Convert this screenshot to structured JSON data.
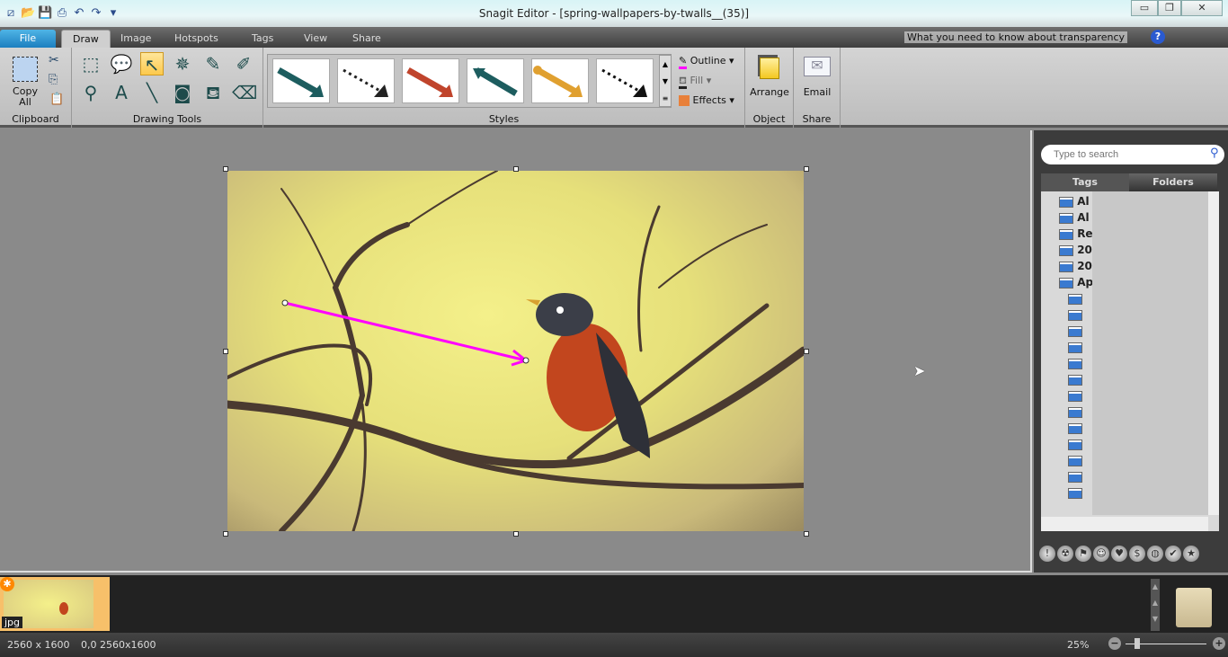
{
  "window": {
    "title": "Snagit Editor - [spring-wallpapers-by-twalls__(35)]",
    "minimize": "▭",
    "restore": "❐",
    "close": "✕"
  },
  "quick_access": [
    {
      "icon": "snagit-logo-icon",
      "glyph": "⧄"
    },
    {
      "icon": "open-folder-icon",
      "glyph": "📂"
    },
    {
      "icon": "save-icon",
      "glyph": "💾"
    },
    {
      "icon": "print-icon",
      "glyph": "⎙"
    },
    {
      "icon": "undo-icon",
      "glyph": "↶"
    },
    {
      "icon": "redo-icon",
      "glyph": "↷"
    },
    {
      "icon": "customize-icon",
      "glyph": "▾"
    }
  ],
  "tabs": [
    {
      "label": "File"
    },
    {
      "label": "Draw"
    },
    {
      "label": "Image"
    },
    {
      "label": "Hotspots"
    },
    {
      "label": "Tags"
    },
    {
      "label": "View"
    },
    {
      "label": "Share"
    }
  ],
  "active_tab": "Draw",
  "help_text": "What you need to know about transparency",
  "ribbon": {
    "clipboard": {
      "label": "Clipboard",
      "copy_all": "Copy\nAll",
      "copy_all_line1": "Copy",
      "copy_all_line2": "All"
    },
    "drawing_tools": {
      "label": "Drawing Tools",
      "tools": [
        {
          "name": "selection",
          "glyph": "⬚"
        },
        {
          "name": "callout",
          "glyph": "💬"
        },
        {
          "name": "arrow",
          "glyph": "↖",
          "selected": true
        },
        {
          "name": "stamp",
          "glyph": "✵"
        },
        {
          "name": "pen",
          "glyph": "✎"
        },
        {
          "name": "highlighter",
          "glyph": "✐"
        },
        {
          "name": "magnifier",
          "glyph": "⚲"
        },
        {
          "name": "text",
          "glyph": "A"
        },
        {
          "name": "line",
          "glyph": "╲"
        },
        {
          "name": "shape",
          "glyph": "◙"
        },
        {
          "name": "fill",
          "glyph": "⛾"
        },
        {
          "name": "eraser",
          "glyph": "⌫"
        }
      ]
    },
    "styles": {
      "label": "Styles",
      "items": [
        {
          "color": "#1d5d5f"
        },
        {
          "color": "#222222"
        },
        {
          "color": "#c0442c"
        },
        {
          "color": "#1d5d5f"
        },
        {
          "color": "#e0a030"
        },
        {
          "color": "#111111"
        }
      ]
    },
    "outline": "Outline",
    "fill": "Fill",
    "effects": "Effects",
    "outline_color": "#ff00ff",
    "object": {
      "label": "Object",
      "arrange": "Arrange"
    },
    "share": {
      "label": "Share",
      "email": "Email"
    }
  },
  "canvas": {
    "arrow_color": "#ff00ff"
  },
  "library": {
    "search_placeholder": "Type to search",
    "tabs": [
      "Tags",
      "Folders"
    ],
    "tree": [
      "Al",
      "Al",
      "Re",
      "20",
      "20",
      "Ap"
    ]
  },
  "filmstrip": {
    "thumb_label": "jpg"
  },
  "status": {
    "dimensions": "2560 x 1600",
    "position": "0,0  2560x1600",
    "zoom": "25%"
  }
}
